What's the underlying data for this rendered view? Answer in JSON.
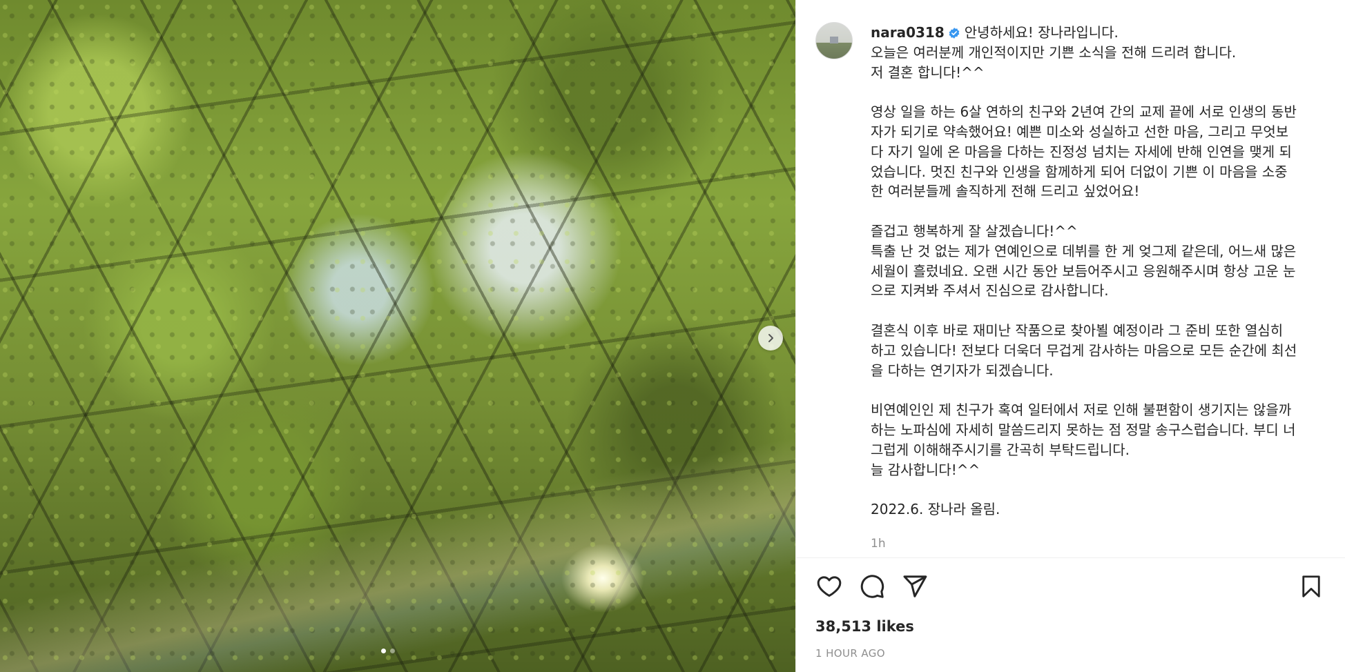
{
  "post": {
    "username": "nara0318",
    "verified": true,
    "caption_lines": [
      "안녕하세요! 장나라입니다.",
      "오늘은 여러분께 개인적이지만 기쁜 소식을 전해 드리려 합니다.",
      "저 결혼 합니다!^^",
      "",
      "영상 일을 하는 6살 연하의 친구와 2년여 간의 교제 끝에 서로 인생의 동반",
      "자가 되기로 약속했어요! 예쁜 미소와 성실하고 선한 마음, 그리고 무엇보",
      "다 자기 일에 온 마음을 다하는 진정성 넘치는 자세에 반해 인연을 맺게 되",
      "었습니다. 멋진 친구와 인생을 함께하게 되어 더없이 기쁜 이 마음을 소중",
      "한 여러분들께 솔직하게 전해 드리고 싶었어요!",
      "",
      "즐겁고 행복하게 잘 살겠습니다!^^",
      "특출 난 것 없는 제가 연예인으로 데뷔를 한 게 엊그제 같은데, 어느새 많은",
      "세월이 흘렀네요. 오랜 시간 동안 보듬어주시고 응원해주시며 항상 고운 눈",
      "으로 지켜봐 주셔서 진심으로 감사합니다.",
      "",
      "결혼식 이후 바로 재미난 작품으로 찾아뵐 예정이라 그 준비 또한 열심히",
      "하고 있습니다! 전보다 더욱더 무겁게 감사하는 마음으로 모든 순간에 최선",
      "을 다하는 연기자가 되겠습니다.",
      "",
      "비연예인인 제 친구가 혹여 일터에서 저로 인해 불편함이 생기지는 않을까",
      "하는 노파심에 자세히 말씀드리지 못하는 점 정말 송구스럽습니다. 부디 너",
      "그럽게 이해해주시기를 간곡히 부탁드립니다.",
      "늘 감사합니다!^^",
      "",
      "2022.6. 장나라 올림."
    ],
    "timestamp": "1h",
    "likes": "38,513 likes",
    "posted_ago": "1 HOUR AGO"
  },
  "carousel": {
    "slides": 2,
    "active_index": 0
  },
  "colors": {
    "verified": "#3897f0",
    "text": "#262626",
    "muted": "#8e8e8e",
    "divider": "#efefef"
  },
  "icons": [
    "chevron-right-icon",
    "verified-badge-icon",
    "heart-icon",
    "comment-icon",
    "share-icon",
    "bookmark-icon"
  ]
}
